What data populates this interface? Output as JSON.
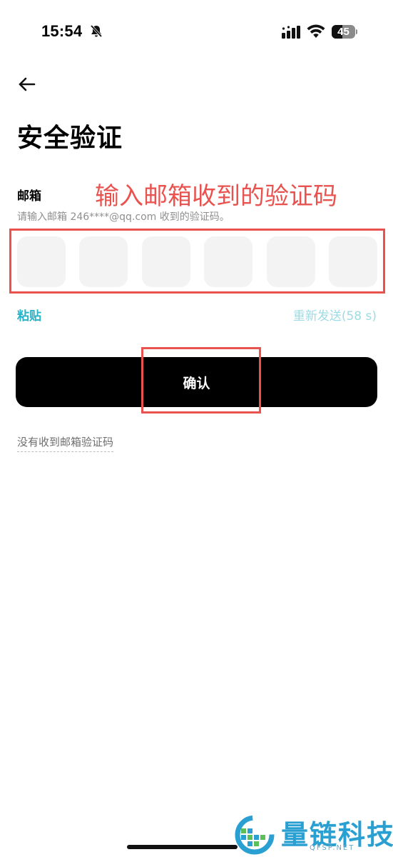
{
  "status_bar": {
    "time": "15:54",
    "battery_level": "45",
    "battery_fraction": 0.45
  },
  "header": {
    "title": "安全验证"
  },
  "form": {
    "field_label": "邮箱",
    "hint": "请输入邮箱 246****@qq.com 收到的验证码。",
    "code_length": 6,
    "paste_label": "粘贴",
    "resend_label": "重新发送(58 s)",
    "confirm_label": "确认",
    "no_code_label": "没有收到邮箱验证码"
  },
  "annotation": {
    "text": "输入邮箱收到的验证码",
    "color": "#e8524f"
  },
  "watermark": {
    "name": "量链科技",
    "domain": "QFSP.NET"
  },
  "colors": {
    "accent": "#28b2c7",
    "accent_disabled": "#9fdbe4",
    "primary_button": "#000000",
    "code_box_bg": "#f3f3f4"
  }
}
